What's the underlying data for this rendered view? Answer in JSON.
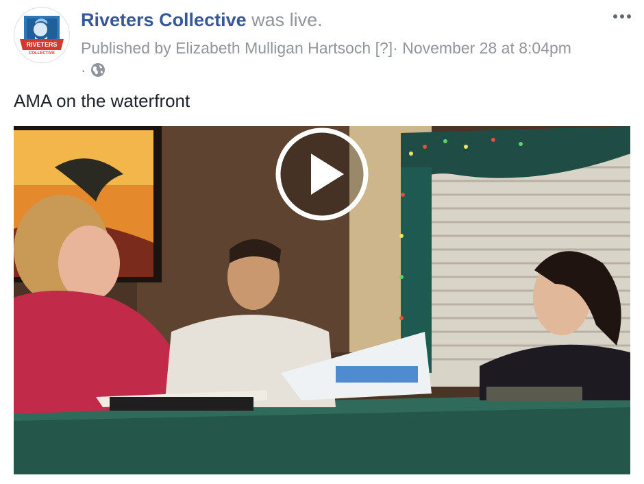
{
  "post": {
    "page_name": "Riveters Collective",
    "status_text": "was live.",
    "published_prefix": "Published by",
    "publisher_name": "Elizabeth Mulligan Hartsoch",
    "help_mark": "[?]",
    "separator": "·",
    "timestamp": "November 28 at 8:04pm",
    "audience_icon": "globe-icon",
    "body_text": "AMA on the waterfront"
  },
  "avatar": {
    "logo_text_top": "RIVETERS",
    "logo_text_bottom": "COLLECTIVE"
  },
  "video": {
    "play_icon": "play-icon"
  },
  "icons": {
    "more": "more-options-icon"
  },
  "colors": {
    "page_link": "#365899",
    "meta_text": "#90949c",
    "body_text": "#1d2129",
    "avatar_blue": "#2f78b7",
    "avatar_red": "#d23a2f"
  }
}
